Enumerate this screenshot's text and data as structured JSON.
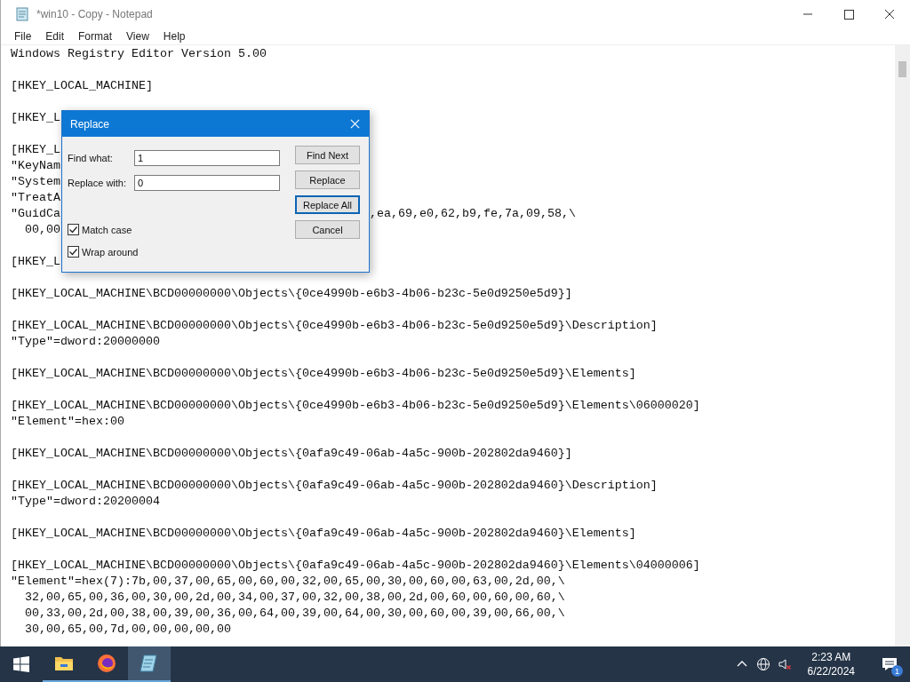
{
  "window": {
    "title": "*win10 - Copy - Notepad"
  },
  "menu": [
    "File",
    "Edit",
    "Format",
    "View",
    "Help"
  ],
  "editor": {
    "blocks": [
      [
        {
          "text": "Windows Registry Editor Version 5.00"
        }
      ],
      [
        {
          "text": "[HKEY_LOCAL_MACHINE]"
        }
      ],
      [
        {
          "text": "[HKEY_L"
        }
      ],
      [
        {
          "text": "[HKEY_L"
        },
        {
          "text": "\"KeyNam"
        },
        {
          "text": "\"System"
        },
        {
          "text": "\"TreatA"
        },
        {
          "text": "\"GuidCa",
          "tail": ",ea,69,e0,62,b9,fe,7a,09,58,\\"
        },
        {
          "text": "  00,00"
        }
      ],
      [
        {
          "text": "[HKEY_L"
        }
      ],
      [
        {
          "text": "[HKEY_LOCAL_MACHINE\\BCD00000000\\Objects\\{0ce4990b-e6b3-4b06-b23c-5e0d9250e5d9}]"
        }
      ],
      [
        {
          "text": "[HKEY_LOCAL_MACHINE\\BCD00000000\\Objects\\{0ce4990b-e6b3-4b06-b23c-5e0d9250e5d9}\\Description]"
        },
        {
          "text": "\"Type\"=dword:20000000"
        }
      ],
      [
        {
          "text": "[HKEY_LOCAL_MACHINE\\BCD00000000\\Objects\\{0ce4990b-e6b3-4b06-b23c-5e0d9250e5d9}\\Elements]"
        }
      ],
      [
        {
          "text": "[HKEY_LOCAL_MACHINE\\BCD00000000\\Objects\\{0ce4990b-e6b3-4b06-b23c-5e0d9250e5d9}\\Elements\\06000020]"
        },
        {
          "text": "\"Element\"=hex:00"
        }
      ],
      [
        {
          "text": "[HKEY_LOCAL_MACHINE\\BCD00000000\\Objects\\{0afa9c49-06ab-4a5c-900b-202802da9460}]"
        }
      ],
      [
        {
          "text": "[HKEY_LOCAL_MACHINE\\BCD00000000\\Objects\\{0afa9c49-06ab-4a5c-900b-202802da9460}\\Description]"
        },
        {
          "text": "\"Type\"=dword:20200004"
        }
      ],
      [
        {
          "text": "[HKEY_LOCAL_MACHINE\\BCD00000000\\Objects\\{0afa9c49-06ab-4a5c-900b-202802da9460}\\Elements]"
        }
      ],
      [
        {
          "text": "[HKEY_LOCAL_MACHINE\\BCD00000000\\Objects\\{0afa9c49-06ab-4a5c-900b-202802da9460}\\Elements\\04000006]"
        },
        {
          "text": "\"Element\"=hex(7):7b,00,37,00,65,00,60,00,32,00,65,00,30,00,60,00,63,00,2d,00,\\"
        },
        {
          "text": "  32,00,65,00,36,00,30,00,2d,00,34,00,37,00,32,00,38,00,2d,00,60,00,60,00,60,\\"
        },
        {
          "text": "  00,33,00,2d,00,38,00,39,00,36,00,64,00,39,00,64,00,30,00,60,00,39,00,66,00,\\"
        },
        {
          "text": "  30,00,65,00,7d,00,00,00,00,00"
        }
      ]
    ]
  },
  "dialog": {
    "title": "Replace",
    "fields": [
      {
        "label": "Find what:",
        "value": "1"
      },
      {
        "label": "Replace with:",
        "value": "0"
      }
    ],
    "buttons": [
      {
        "label": "Find Next",
        "selected": false
      },
      {
        "label": "Replace",
        "selected": false
      },
      {
        "label": "Replace All",
        "selected": true
      },
      {
        "label": "Cancel",
        "selected": false
      }
    ],
    "options": [
      {
        "label": "Match case",
        "checked": true
      },
      {
        "label": "Wrap around",
        "checked": true
      }
    ]
  },
  "taskbar": {
    "apps": [
      {
        "kind": "explorer",
        "selected": false
      },
      {
        "kind": "firefox",
        "selected": false
      },
      {
        "kind": "notepad",
        "selected": true
      }
    ],
    "time": "2:23 AM",
    "date": "6/22/2024",
    "notifications": "1"
  }
}
